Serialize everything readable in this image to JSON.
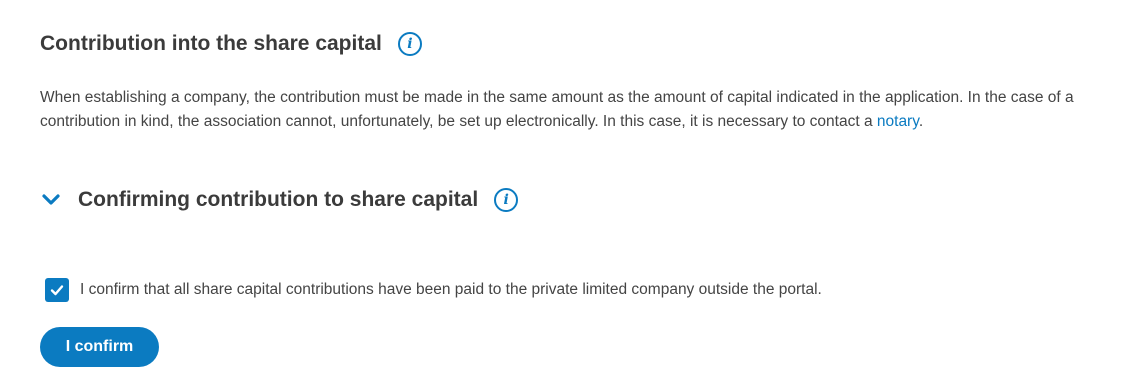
{
  "section": {
    "title": "Contribution into the share capital",
    "description_pre": "When establishing a company, the contribution must be made in the same amount as the amount of capital indicated in the application. In the case of a contribution in kind, the association cannot, unfortunately, be set up electronically. In this case, it is necessary to contact a ",
    "description_link": "notary",
    "description_post": ".",
    "info_icon": "info-icon"
  },
  "confirming": {
    "title": "Confirming contribution to share capital",
    "expanded": true,
    "chevron_icon": "chevron-down-icon",
    "info_icon": "info-icon",
    "checkbox_checked": true,
    "checkbox_label": "I confirm that all share capital contributions have been paid to the private limited company outside the portal.",
    "button_label": "I confirm"
  },
  "colors": {
    "accent": "#0b7bc1",
    "heading": "#3b3b3b",
    "text": "#444444"
  }
}
